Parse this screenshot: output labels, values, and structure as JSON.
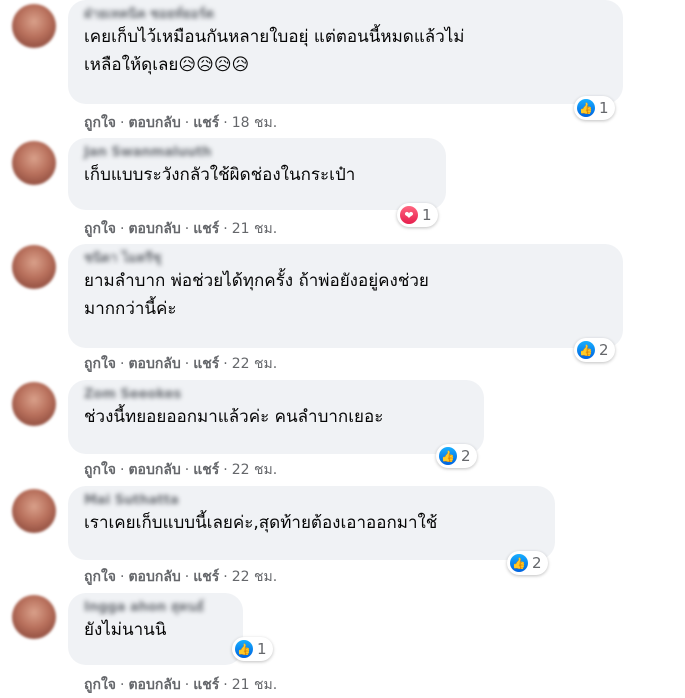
{
  "labels": {
    "like": "ถูกใจ",
    "reply": "ตอบกลับ",
    "share": "แชร์",
    "dot": "·"
  },
  "comments": [
    {
      "author": "ฝ่ายเทคนิค ซอยท์ยอร์ต",
      "text": "เคยเก็บไว้เหมือนกันหลายใบอยุ่ แต่ตอนนี้หมดแล้วไม่\nเหลือให้ดุเลย😥😥😥😥",
      "time": "18 ชม.",
      "reaction_icon": "like-icon",
      "reaction_count": "1"
    },
    {
      "author": "Jan Swanmaluuth",
      "text": "เก็บแบบระวังกลัวใช้ผิดช่องในกระเป๋า",
      "time": "21 ชม.",
      "reaction_icon": "love-icon",
      "reaction_count": "1"
    },
    {
      "author": "ชนิดา ไมตรีชุ",
      "text": "ยามลำบาก พ่อช่วยได้ทุกครั้ง ถ้าพ่อยังอยู่คงช่วย\nมากกว่านี้ค่ะ",
      "time": "22 ชม.",
      "reaction_icon": "like-icon",
      "reaction_count": "2"
    },
    {
      "author": "Zom Seeokes",
      "text": "ช่วงนี้ทยอยออกมาแล้วค่ะ คนลำบากเยอะ",
      "time": "22 ชม.",
      "reaction_icon": "like-icon",
      "reaction_count": "2"
    },
    {
      "author": "Mai Suthatta",
      "text": "เราเคยเก็บแบบนี้เลยค่ะ,สุดท้ายต้องเอาออกมาใช้",
      "time": "22 ชม.",
      "reaction_icon": "like-icon",
      "reaction_count": "2"
    },
    {
      "author": "Ingga ahon สุคนธ์",
      "text": "ยังไม่นานนิ",
      "time": "21 ชม.",
      "reaction_icon": "like-icon",
      "reaction_count": "1"
    }
  ]
}
